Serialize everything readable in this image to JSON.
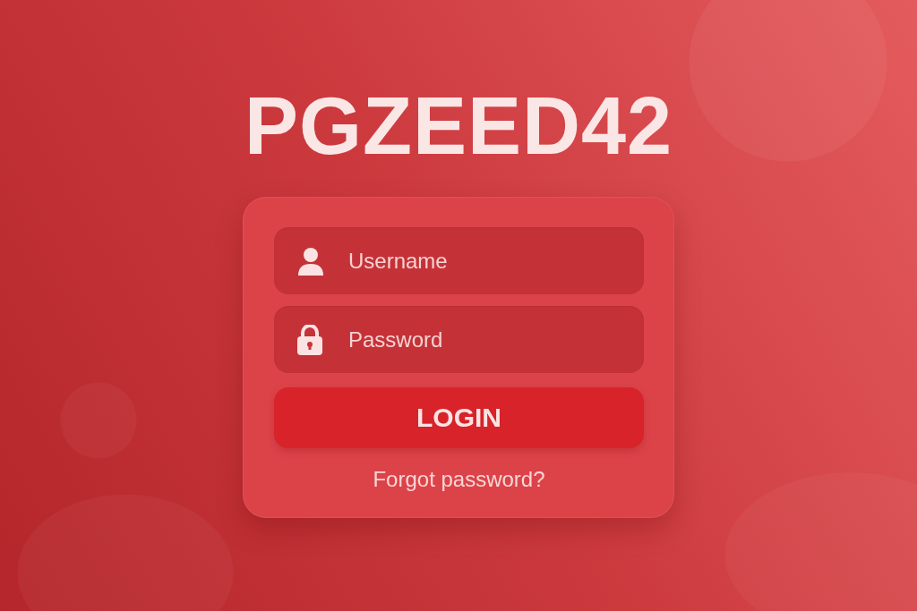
{
  "title": "PGZEED42",
  "fields": [
    {
      "kind": "username",
      "placeholder": "Username"
    },
    {
      "kind": "password",
      "placeholder": "Password"
    }
  ],
  "login_button": "LOGIN",
  "forgot_link": "Forgot password?"
}
